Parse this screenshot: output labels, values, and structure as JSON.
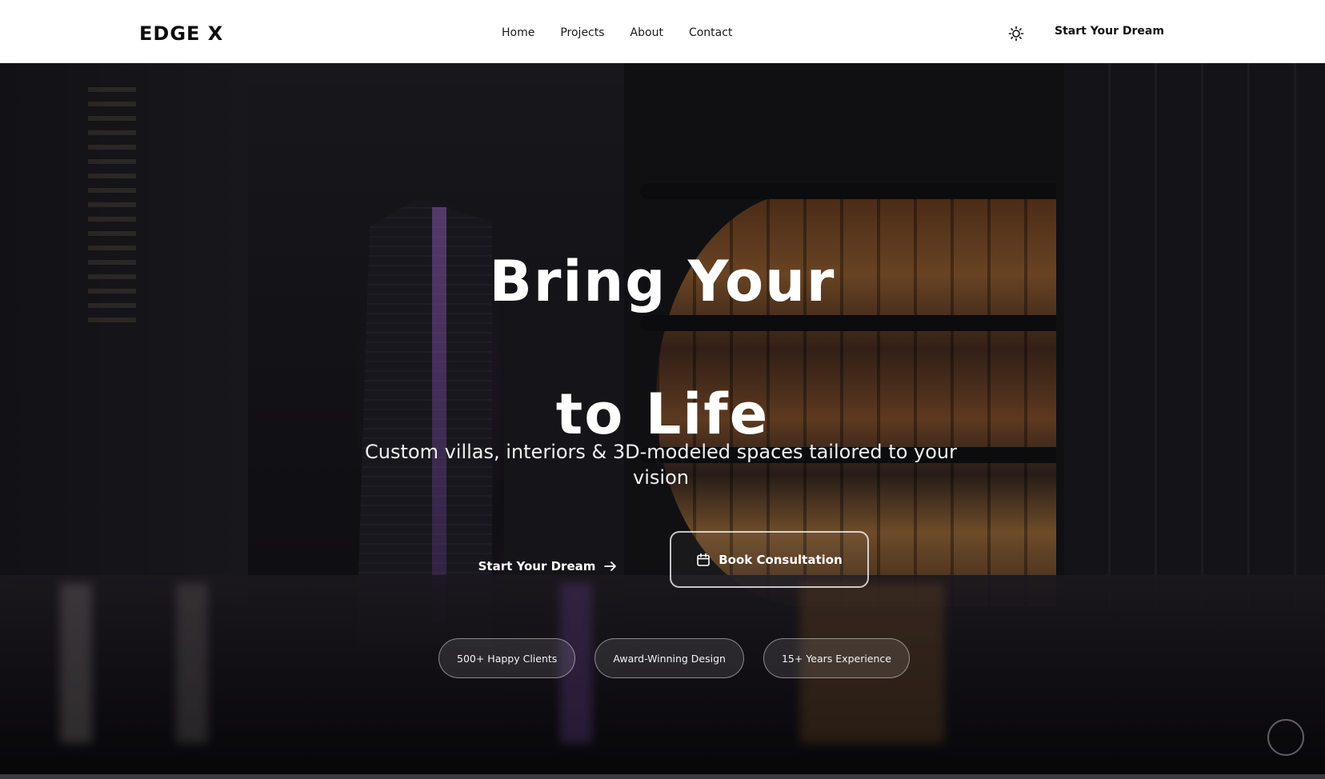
{
  "brand": {
    "logo_text": "EDGE X"
  },
  "nav": {
    "links": [
      "Home",
      "Projects",
      "About",
      "Contact"
    ],
    "theme_icon": "sun-icon",
    "cta_label": "Start Your Dream"
  },
  "hero": {
    "title_line1": "Bring Your",
    "title_line2": "to Life",
    "subtitle": "Custom villas, interiors & 3D-modeled spaces tailored to your vision",
    "primary_button": {
      "label": "Start Your Dream",
      "icon": "arrow-right-icon"
    },
    "secondary_button": {
      "label": "Book Consultation",
      "icon": "calendar-icon"
    },
    "badges": [
      "500+ Happy Clients",
      "Award-Winning Design",
      "15+ Years Experience"
    ]
  },
  "colors": {
    "nav_bg": "#ffffff",
    "text_dark": "#111111",
    "text_light": "#ffffff",
    "accent_warm": "#c4783a",
    "accent_purple": "#8c50be"
  }
}
